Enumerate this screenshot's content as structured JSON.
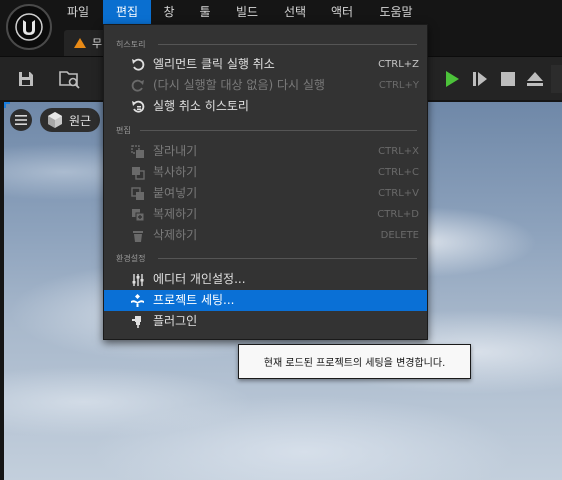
{
  "menu_bar": {
    "items": [
      {
        "label": "파일"
      },
      {
        "label": "편집"
      },
      {
        "label": "창"
      },
      {
        "label": "툴"
      },
      {
        "label": "빌드"
      },
      {
        "label": "선택"
      },
      {
        "label": "액터"
      },
      {
        "label": "도움말"
      }
    ],
    "active_index": 1
  },
  "tab": {
    "label": "무"
  },
  "viewport": {
    "perspective_label": "원근"
  },
  "edit_menu": {
    "sections": [
      {
        "title": "히스토리",
        "items": [
          {
            "label": "엘리먼트 클릭 실행 취소",
            "shortcut": "CTRL+Z",
            "icon": "undo-icon",
            "enabled": true
          },
          {
            "label": "(다시 실행할 대상 없음) 다시 실행",
            "shortcut": "CTRL+Y",
            "icon": "redo-icon",
            "enabled": false
          },
          {
            "label": "실행 취소 히스토리",
            "shortcut": "",
            "icon": "undo-history-icon",
            "enabled": true
          }
        ]
      },
      {
        "title": "편집",
        "items": [
          {
            "label": "잘라내기",
            "shortcut": "CTRL+X",
            "icon": "cut-icon",
            "enabled": false
          },
          {
            "label": "복사하기",
            "shortcut": "CTRL+C",
            "icon": "copy-icon",
            "enabled": false
          },
          {
            "label": "붙여넣기",
            "shortcut": "CTRL+V",
            "icon": "paste-icon",
            "enabled": false
          },
          {
            "label": "복제하기",
            "shortcut": "CTRL+D",
            "icon": "duplicate-icon",
            "enabled": false
          },
          {
            "label": "삭제하기",
            "shortcut": "DELETE",
            "icon": "delete-icon",
            "enabled": false
          }
        ]
      },
      {
        "title": "환경설정",
        "items": [
          {
            "label": "에디터 개인설정...",
            "shortcut": "",
            "icon": "sliders-icon",
            "enabled": true
          },
          {
            "label": "프로젝트 세팅...",
            "shortcut": "",
            "icon": "project-settings-icon",
            "enabled": true,
            "highlighted": true
          },
          {
            "label": "플러그인",
            "shortcut": "",
            "icon": "plugin-icon",
            "enabled": true
          }
        ]
      }
    ]
  },
  "tooltip": {
    "text": "현재 로드된 프로젝트의 세팅을 변경합니다."
  },
  "colors": {
    "accent_blue": "#0a70d6",
    "play_green": "#4cc23a",
    "menu_background": "#333333",
    "tab_orange": "#e88a16"
  }
}
